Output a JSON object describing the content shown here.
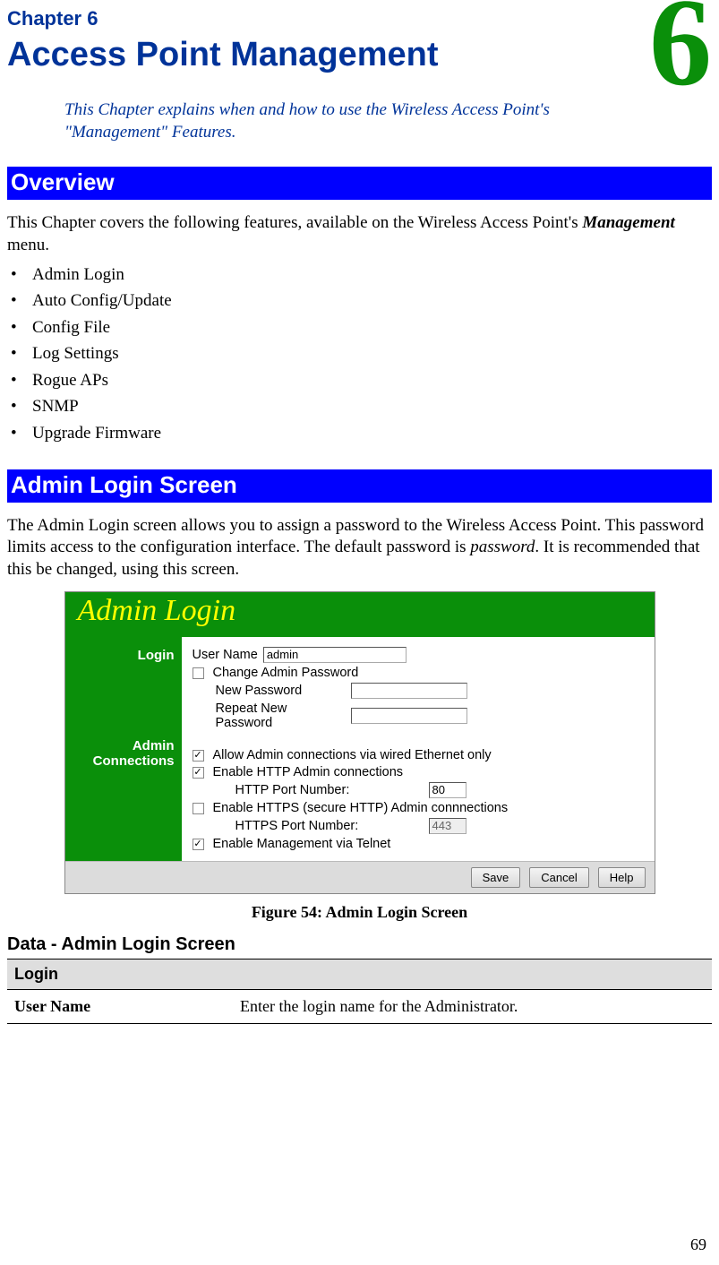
{
  "chapter_badge": "6",
  "chapter_label": "Chapter 6",
  "title": "Access Point Management",
  "intro": "This Chapter explains when and how to use the Wireless Access Point's \"Management\" Features.",
  "overview": {
    "heading": "Overview",
    "text_pre": "This Chapter covers the following features, available on the Wireless Access Point's ",
    "text_em": "Management",
    "text_post": " menu.",
    "items": [
      "Admin Login",
      "Auto Config/Update",
      "Config File",
      "Log Settings",
      "Rogue APs",
      "SNMP",
      "Upgrade Firmware"
    ]
  },
  "admin_screen": {
    "heading": "Admin Login Screen",
    "para_pre": "The Admin Login screen allows you to assign a password to the Wireless Access Point. This password limits access to the configuration interface. The default password is ",
    "para_em": "password",
    "para_post": ". It is recommended that this be changed, using this screen."
  },
  "figure": {
    "title": "Admin Login",
    "side_label_1": "Login",
    "side_label_2": "Admin Connections",
    "user_name_label": "User Name",
    "user_name_value": "admin",
    "cb_change": "Change Admin Password",
    "new_pw": "New Password",
    "repeat_pw": "Repeat New Password",
    "cb_wired": "Allow Admin connections via wired Ethernet only",
    "cb_http": "Enable HTTP Admin connections",
    "http_port_label": "HTTP Port Number:",
    "http_port_value": "80",
    "cb_https": "Enable HTTPS (secure HTTP) Admin connnections",
    "https_port_label": "HTTPS Port Number:",
    "https_port_value": "443",
    "cb_telnet": "Enable Management via Telnet",
    "btn_save": "Save",
    "btn_cancel": "Cancel",
    "btn_help": "Help",
    "caption": "Figure 54: Admin Login Screen"
  },
  "data_table": {
    "heading": "Data - Admin Login Screen",
    "section": "Login",
    "row_key": "User Name",
    "row_val": "Enter the login name for the Administrator."
  },
  "page_number": "69"
}
